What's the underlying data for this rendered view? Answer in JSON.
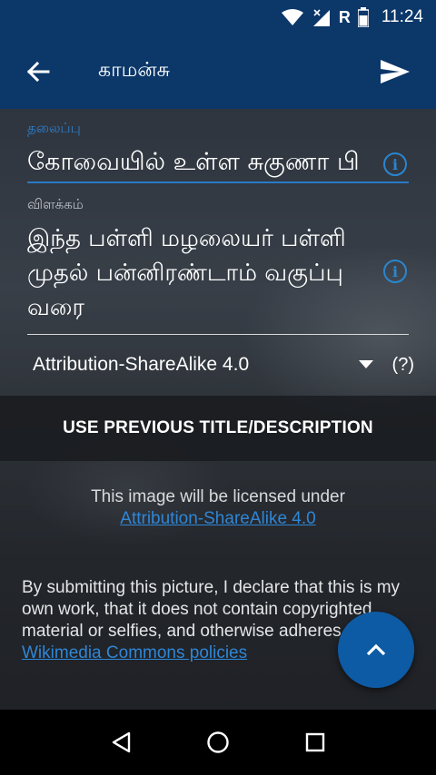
{
  "status_bar": {
    "time": "11:24",
    "network_label": "R"
  },
  "app_bar": {
    "title": "காமன்சு"
  },
  "title_field": {
    "label": "தலைப்பு",
    "value": "கோவையில் உள்ள சுகுணா பி"
  },
  "description_field": {
    "label": "விளக்கம்",
    "value": "இந்த பள்ளி மழலையர் பள்ளி முதல் பன்னிரண்டாம் வகுப்பு வரை"
  },
  "license": {
    "selected": "Attribution-ShareAlike 4.0",
    "help": "(?)"
  },
  "previous_button": {
    "label": "USE PREVIOUS TITLE/DESCRIPTION"
  },
  "license_notice": {
    "text": "This image will be licensed under",
    "link": "Attribution-ShareAlike 4.0"
  },
  "declaration": {
    "text": "By submitting this picture, I declare that this is my own work, that it does not contain copyrighted material or selfies, and otherwise adheres to",
    "link": "Wikimedia Commons policies"
  },
  "colors": {
    "app_bar": "#0b3769",
    "accent": "#2a86cf",
    "fab": "#0e5ba5"
  }
}
